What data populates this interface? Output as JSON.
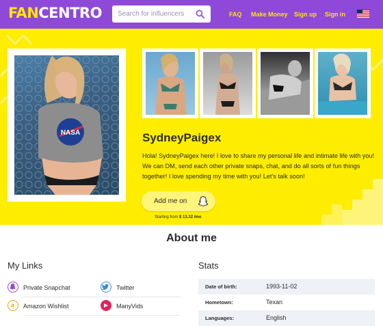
{
  "nav": {
    "logo_fan": "FAN",
    "logo_centro": "CENTRO",
    "search_placeholder": "Search for influencers",
    "links": [
      "FAQ",
      "Make Money",
      "Sign up",
      "Sign in"
    ],
    "flag": "us-flag-icon"
  },
  "profile": {
    "name": "SydneyPaigex",
    "bio": "Hola! SydneyPaigex here! I love to share  my personal life and intimate life with you! We can DM, send each other private snaps, chat, and do all sorts of fun things together! I love spending my time with you! Let's talk soon!",
    "add_button_label": "Add me on",
    "add_button_icon": "snapchat-ghost-icon",
    "starting_prefix": "Starting from",
    "starting_price": "$ 13.32",
    "starting_suffix": "/mo",
    "shirt_text": "NASA"
  },
  "about": {
    "heading": "About me",
    "links_title": "My Links",
    "links": [
      {
        "label": "Private Snapchat",
        "icon": "snapchat-icon",
        "color": "#8f49d9"
      },
      {
        "label": "Twitter",
        "icon": "twitter-icon",
        "color": "#3b8ed9"
      },
      {
        "label": "Amazon Wishlist",
        "icon": "amazon-icon",
        "color": "#f0a30a"
      },
      {
        "label": "ManyVids",
        "icon": "manyvids-icon",
        "color": "#e0245e"
      }
    ],
    "stats_title": "Stats",
    "stats": [
      {
        "key": "Date of birth:",
        "value": "1993-11-02"
      },
      {
        "key": "Hometown:",
        "value": "Texan"
      },
      {
        "key": "Languages:",
        "value": "English"
      }
    ]
  },
  "colors": {
    "brand_purple": "#8f49d9",
    "hero_yellow": "#ffed00",
    "logo_yellow": "#ffe600"
  }
}
